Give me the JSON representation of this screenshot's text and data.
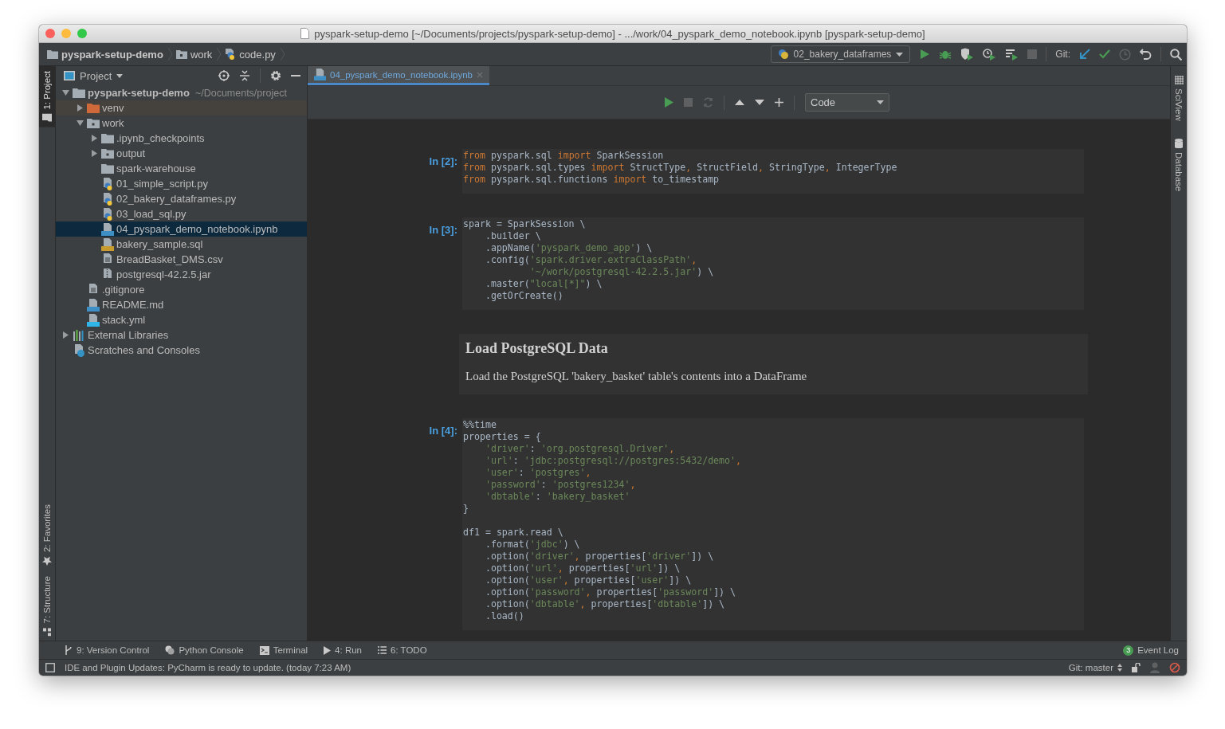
{
  "window": {
    "title": "pyspark-setup-demo [~/Documents/projects/pyspark-setup-demo] - .../work/04_pyspark_demo_notebook.ipynb [pyspark-setup-demo]"
  },
  "breadcrumbs": [
    {
      "label": "pyspark-setup-demo",
      "kind": "folder"
    },
    {
      "label": "work",
      "kind": "module"
    },
    {
      "label": "code.py",
      "kind": "py"
    }
  ],
  "run_config": {
    "label": "02_bakery_dataframes"
  },
  "git_label": "Git:",
  "left_tabs": [
    {
      "label": "1: Project",
      "kind": "folder",
      "selected": true
    },
    {
      "label": "2: Favorites",
      "kind": "star",
      "selected": false
    },
    {
      "label": "7: Structure",
      "kind": "structure",
      "selected": false
    }
  ],
  "right_tabs": [
    {
      "label": "SciView",
      "kind": "grid"
    },
    {
      "label": "Database",
      "kind": "database"
    }
  ],
  "project": {
    "title": "Project",
    "tree": [
      {
        "label": "pyspark-setup-demo",
        "hint": "~/Documents/project",
        "kind": "folder",
        "expanded": true,
        "selected": false,
        "children": [
          {
            "label": "venv",
            "kind": "excluded",
            "expanded": false,
            "selected": false
          },
          {
            "label": "work",
            "kind": "module",
            "expanded": true,
            "selected": false,
            "children": [
              {
                "label": ".ipynb_checkpoints",
                "kind": "folder",
                "expanded": false,
                "selected": false
              },
              {
                "label": "output",
                "kind": "module",
                "expanded": false,
                "selected": false
              },
              {
                "label": "spark-warehouse",
                "kind": "folder",
                "selected": false
              },
              {
                "label": "01_simple_script.py",
                "kind": "py",
                "selected": false
              },
              {
                "label": "02_bakery_dataframes.py",
                "kind": "py",
                "selected": false
              },
              {
                "label": "03_load_sql.py",
                "kind": "py",
                "selected": false
              },
              {
                "label": "04_pyspark_demo_notebook.ipynb",
                "kind": "ipynb",
                "selected": true
              },
              {
                "label": "bakery_sample.sql",
                "kind": "sql",
                "selected": false
              },
              {
                "label": "BreadBasket_DMS.csv",
                "kind": "text",
                "selected": false
              },
              {
                "label": "postgresql-42.2.5.jar",
                "kind": "jar",
                "selected": false
              }
            ]
          },
          {
            "label": ".gitignore",
            "kind": "text",
            "selected": false
          },
          {
            "label": "README.md",
            "kind": "md",
            "selected": false
          },
          {
            "label": "stack.yml",
            "kind": "yml",
            "selected": false
          }
        ]
      },
      {
        "label": "External Libraries",
        "kind": "libraries",
        "expanded": false,
        "selected": false
      },
      {
        "label": "Scratches and Consoles",
        "kind": "scratches",
        "selected": false
      }
    ]
  },
  "editor": {
    "tabs": [
      {
        "label": "04_pyspark_demo_notebook.ipynb",
        "selected": true
      }
    ],
    "cell_type": "Code",
    "cells": [
      {
        "kind": "code",
        "prompt": "In [2]:",
        "blocks": [
          [
            [
              {
                "kind": "keyword",
                "text": "from"
              },
              {
                "kind": "plain",
                "text": " pyspark.sql "
              },
              {
                "kind": "keyword",
                "text": "import"
              },
              {
                "kind": "plain",
                "text": " SparkSession"
              }
            ],
            [
              {
                "kind": "keyword",
                "text": "from"
              },
              {
                "kind": "plain",
                "text": " pyspark.sql.types "
              },
              {
                "kind": "keyword",
                "text": "import"
              },
              {
                "kind": "plain",
                "text": " StructType"
              },
              {
                "kind": "keyword",
                "text": ","
              },
              {
                "kind": "plain",
                "text": " StructField"
              },
              {
                "kind": "keyword",
                "text": ","
              },
              {
                "kind": "plain",
                "text": " StringType"
              },
              {
                "kind": "keyword",
                "text": ","
              },
              {
                "kind": "plain",
                "text": " IntegerType"
              }
            ],
            [
              {
                "kind": "keyword",
                "text": "from"
              },
              {
                "kind": "plain",
                "text": " pyspark.sql.functions "
              },
              {
                "kind": "keyword",
                "text": "import"
              },
              {
                "kind": "plain",
                "text": " to_timestamp"
              }
            ]
          ]
        ]
      },
      {
        "kind": "code",
        "prompt": "In [3]:",
        "blocks": [
          [
            [
              {
                "kind": "plain",
                "text": "spark = SparkSession \\"
              }
            ],
            [
              {
                "kind": "plain",
                "text": "    .builder \\"
              }
            ],
            [
              {
                "kind": "plain",
                "text": "    .appName("
              },
              {
                "kind": "string",
                "text": "'pyspark_demo_app'"
              },
              {
                "kind": "plain",
                "text": ") \\"
              }
            ],
            [
              {
                "kind": "plain",
                "text": "    .config("
              },
              {
                "kind": "string",
                "text": "'spark.driver.extraClassPath'"
              },
              {
                "kind": "keyword",
                "text": ","
              }
            ],
            [
              {
                "kind": "string",
                "text": "            '~/work/postgresql-42.2.5.jar'"
              },
              {
                "kind": "plain",
                "text": ") \\"
              }
            ],
            [
              {
                "kind": "plain",
                "text": "    .master("
              },
              {
                "kind": "string",
                "text": "\"local[*]\""
              },
              {
                "kind": "plain",
                "text": ") \\"
              }
            ],
            [
              {
                "kind": "plain",
                "text": "    .getOrCreate()"
              }
            ]
          ]
        ]
      },
      {
        "kind": "markdown",
        "heading": "Load PostgreSQL Data",
        "text": "Load the PostgreSQL 'bakery_basket' table's contents into a DataFrame"
      },
      {
        "kind": "code",
        "prompt": "In [4]:",
        "blocks": [
          [
            [
              {
                "kind": "plain",
                "text": "%%time"
              }
            ],
            [
              {
                "kind": "plain",
                "text": "properties = {"
              }
            ],
            [
              {
                "kind": "string",
                "text": "    'driver'"
              },
              {
                "kind": "plain",
                "text": ": "
              },
              {
                "kind": "string",
                "text": "'org.postgresql.Driver'"
              },
              {
                "kind": "keyword",
                "text": ","
              }
            ],
            [
              {
                "kind": "string",
                "text": "    'url'"
              },
              {
                "kind": "plain",
                "text": ": "
              },
              {
                "kind": "string",
                "text": "'jdbc:postgresql://postgres:5432/demo'"
              },
              {
                "kind": "keyword",
                "text": ","
              }
            ],
            [
              {
                "kind": "string",
                "text": "    'user'"
              },
              {
                "kind": "plain",
                "text": ": "
              },
              {
                "kind": "string",
                "text": "'postgres'"
              },
              {
                "kind": "keyword",
                "text": ","
              }
            ],
            [
              {
                "kind": "string",
                "text": "    'password'"
              },
              {
                "kind": "plain",
                "text": ": "
              },
              {
                "kind": "string",
                "text": "'postgres1234'"
              },
              {
                "kind": "keyword",
                "text": ","
              }
            ],
            [
              {
                "kind": "string",
                "text": "    'dbtable'"
              },
              {
                "kind": "plain",
                "text": ": "
              },
              {
                "kind": "string",
                "text": "'bakery_basket'"
              }
            ],
            [
              {
                "kind": "plain",
                "text": "}"
              }
            ]
          ],
          [
            [
              {
                "kind": "plain",
                "text": "df1 = spark.read \\"
              }
            ],
            [
              {
                "kind": "plain",
                "text": "    .format("
              },
              {
                "kind": "string",
                "text": "'jdbc'"
              },
              {
                "kind": "plain",
                "text": ") \\"
              }
            ],
            [
              {
                "kind": "plain",
                "text": "    .option("
              },
              {
                "kind": "string",
                "text": "'driver'"
              },
              {
                "kind": "keyword",
                "text": ","
              },
              {
                "kind": "plain",
                "text": " properties["
              },
              {
                "kind": "string",
                "text": "'driver'"
              },
              {
                "kind": "plain",
                "text": "]) \\"
              }
            ],
            [
              {
                "kind": "plain",
                "text": "    .option("
              },
              {
                "kind": "string",
                "text": "'url'"
              },
              {
                "kind": "keyword",
                "text": ","
              },
              {
                "kind": "plain",
                "text": " properties["
              },
              {
                "kind": "string",
                "text": "'url'"
              },
              {
                "kind": "plain",
                "text": "]) \\"
              }
            ],
            [
              {
                "kind": "plain",
                "text": "    .option("
              },
              {
                "kind": "string",
                "text": "'user'"
              },
              {
                "kind": "keyword",
                "text": ","
              },
              {
                "kind": "plain",
                "text": " properties["
              },
              {
                "kind": "string",
                "text": "'user'"
              },
              {
                "kind": "plain",
                "text": "]) \\"
              }
            ],
            [
              {
                "kind": "plain",
                "text": "    .option("
              },
              {
                "kind": "string",
                "text": "'password'"
              },
              {
                "kind": "keyword",
                "text": ","
              },
              {
                "kind": "plain",
                "text": " properties["
              },
              {
                "kind": "string",
                "text": "'password'"
              },
              {
                "kind": "plain",
                "text": "]) \\"
              }
            ],
            [
              {
                "kind": "plain",
                "text": "    .option("
              },
              {
                "kind": "string",
                "text": "'dbtable'"
              },
              {
                "kind": "keyword",
                "text": ","
              },
              {
                "kind": "plain",
                "text": " properties["
              },
              {
                "kind": "string",
                "text": "'dbtable'"
              },
              {
                "kind": "plain",
                "text": "]) \\"
              }
            ],
            [
              {
                "kind": "plain",
                "text": "    .load()"
              }
            ]
          ]
        ]
      }
    ]
  },
  "tool_windows": [
    {
      "label": "9: Version Control",
      "kind": "vcs"
    },
    {
      "label": "Python Console",
      "kind": "python"
    },
    {
      "label": "Terminal",
      "kind": "terminal"
    },
    {
      "label": "4: Run",
      "kind": "run"
    },
    {
      "label": "6: TODO",
      "kind": "todo"
    }
  ],
  "event_log": {
    "count": "3",
    "label": "Event Log"
  },
  "status": {
    "message": "IDE and Plugin Updates: PyCharm is ready to update. (today 7:23 AM)",
    "branch": "Git: master"
  }
}
